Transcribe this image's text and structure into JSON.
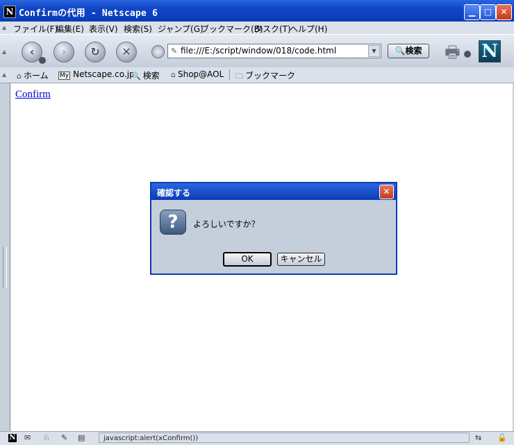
{
  "window": {
    "title": "Confirmの代用 - Netscape 6",
    "app_icon": "N",
    "minimize_glyph": "▁",
    "maximize_glyph": "□",
    "close_glyph": "✕"
  },
  "menubar": {
    "items": [
      "ファイル(F)",
      "編集(E)",
      "表示(V)",
      "検索(S)",
      "ジャンプ(G)",
      "ブックマーク(B)",
      "タスク(T)",
      "ヘルプ(H)"
    ]
  },
  "navbar": {
    "back_glyph": "‹",
    "forward_glyph": "›",
    "reload_glyph": "↻",
    "stop_glyph": "✕",
    "url": "file:///E:/script/window/018/code.html",
    "search_label": "🔍検索",
    "logo": "N"
  },
  "personal_toolbar": {
    "items": [
      {
        "icon": "home-icon",
        "label": "ホーム"
      },
      {
        "icon": "my-icon",
        "label": "Netscape.co.jp"
      },
      {
        "icon": "search-icon",
        "label": "検索"
      },
      {
        "icon": "shop-icon",
        "label": "Shop@AOL"
      },
      {
        "icon": "folder-icon",
        "label": "ブックマーク"
      }
    ],
    "my_badge": "My"
  },
  "content": {
    "link_text": "Confirm"
  },
  "dialog": {
    "title": "確認する",
    "message": "よろしいですか？",
    "ok_label": "OK",
    "cancel_label": "キャンセル",
    "question_glyph": "?"
  },
  "statusbar": {
    "text": "javascript:alert(xConfirm())"
  }
}
